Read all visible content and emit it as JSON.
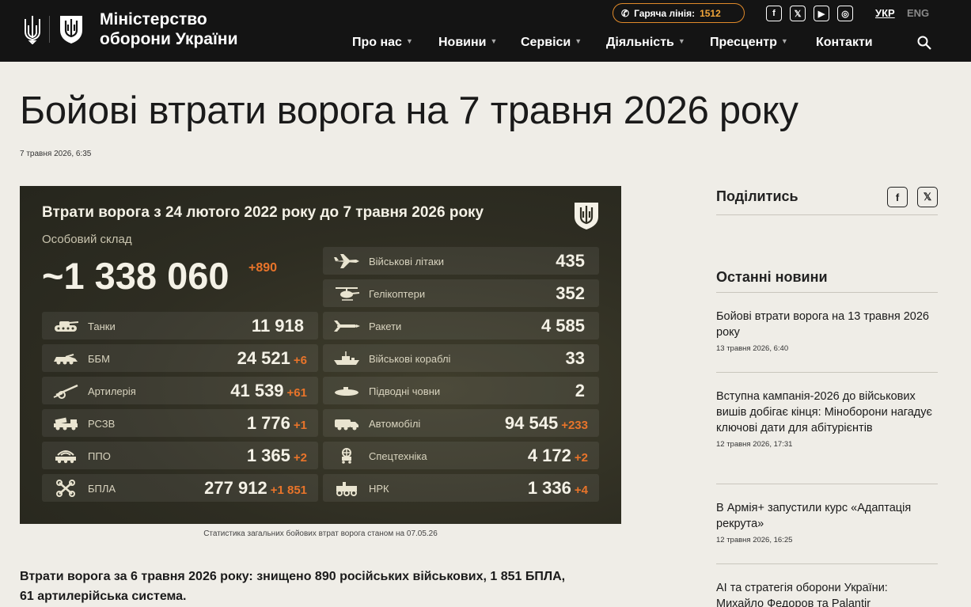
{
  "header": {
    "logo_line1": "Міністерство",
    "logo_line2": "оборони України",
    "hotline_label": "Гаряча лінія:",
    "hotline_number": "1512",
    "social_icons": [
      "facebook-icon",
      "x-icon",
      "youtube-icon",
      "instagram-icon"
    ],
    "lang_active": "УКР",
    "lang_other": "ENG",
    "nav": [
      "Про нас",
      "Новини",
      "Сервіси",
      "Діяльність",
      "Пресцентр",
      "Контакти"
    ]
  },
  "article": {
    "title": "Бойові втрати ворога на 7 травня 2026 року",
    "date": "7 травня 2026, 6:35",
    "caption": "Статистика загальних бойових втрат ворога станом на 07.05.26",
    "lead_line1": "Втрати ворога за 6 травня 2026 року: знищено 890 російських військових, 1 851 БПЛА,",
    "lead_line2": "61 артилерійська система."
  },
  "infographic": {
    "title": "Втрати ворога з 24 лютого 2022 року до 7 травня 2026 року",
    "personnel_label": "Особовий склад",
    "personnel_value": "~1 338 060",
    "personnel_delta": "+890",
    "left_rows": [
      {
        "label": "Танки",
        "value": "11 918",
        "delta": ""
      },
      {
        "label": "ББМ",
        "value": "24 521",
        "delta": "+6"
      },
      {
        "label": "Артилерія",
        "value": "41 539",
        "delta": "+61"
      },
      {
        "label": "РСЗВ",
        "value": "1 776",
        "delta": "+1"
      },
      {
        "label": "ППО",
        "value": "1 365",
        "delta": "+2"
      },
      {
        "label": "БПЛА",
        "value": "277 912",
        "delta": "+1 851"
      }
    ],
    "right_rows": [
      {
        "label": "Військові літаки",
        "value": "435",
        "delta": ""
      },
      {
        "label": "Гелікоптери",
        "value": "352",
        "delta": ""
      },
      {
        "label": "Ракети",
        "value": "4 585",
        "delta": ""
      },
      {
        "label": "Військові кораблі",
        "value": "33",
        "delta": ""
      },
      {
        "label": "Підводні човни",
        "value": "2",
        "delta": ""
      },
      {
        "label": "Автомобілі",
        "value": "94 545",
        "delta": "+233"
      },
      {
        "label": "Спецтехніка",
        "value": "4 172",
        "delta": "+2"
      },
      {
        "label": "НРК",
        "value": "1 336",
        "delta": "+4"
      }
    ]
  },
  "sidebar": {
    "share_title": "Поділитись",
    "news_title": "Останні новини",
    "news": [
      {
        "title": "Бойові втрати ворога на 13 травня 2026 року",
        "date": "13 травня 2026, 6:40"
      },
      {
        "title": "Вступна кампанія-2026 до військових вишів добігає кінця: Міноборони нагадує ключові дати для абітурієнтів",
        "date": "12 травня 2026, 17:31"
      },
      {
        "title": "В Армія+ запустили курс «Адаптація рекрута»",
        "date": "12 травня 2026, 16:25"
      },
      {
        "title": "AI та стратегія оборони України: Михайло Федоров та Palantir",
        "date": ""
      }
    ]
  },
  "colors": {
    "header_bg": "#141414",
    "accent_orange": "#e8742a",
    "infographic_bg": "#2e2d22",
    "page_bg": "#efede7"
  }
}
